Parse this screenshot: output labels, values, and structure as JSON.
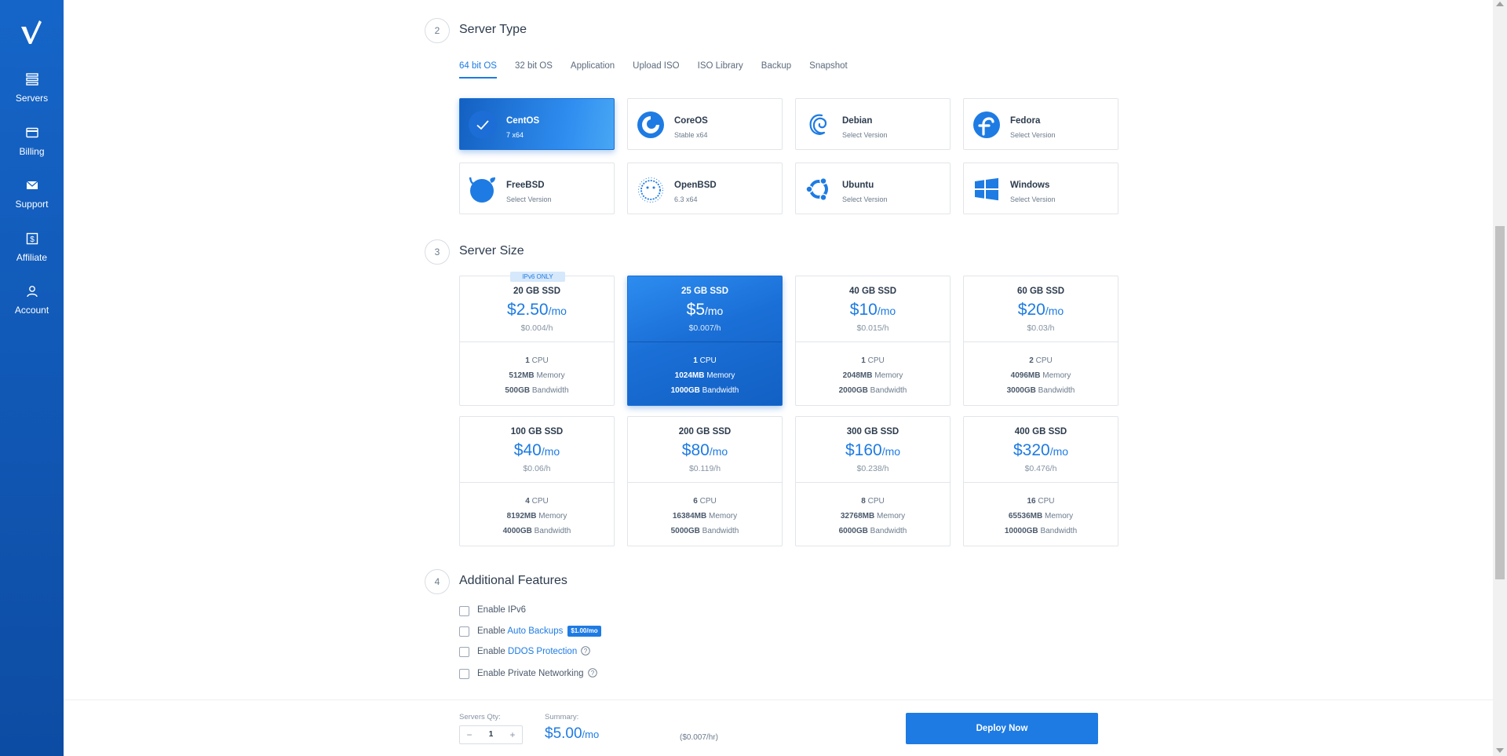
{
  "sidebar": {
    "items": [
      {
        "label": "Servers",
        "icon": "servers-icon"
      },
      {
        "label": "Billing",
        "icon": "billing-icon"
      },
      {
        "label": "Support",
        "icon": "support-icon"
      },
      {
        "label": "Affiliate",
        "icon": "affiliate-icon"
      },
      {
        "label": "Account",
        "icon": "account-icon"
      }
    ]
  },
  "server_type": {
    "step": "2",
    "title": "Server Type",
    "tabs": [
      "64 bit OS",
      "32 bit OS",
      "Application",
      "Upload ISO",
      "ISO Library",
      "Backup",
      "Snapshot"
    ],
    "active_tab": "64 bit OS",
    "os": [
      {
        "name": "CentOS",
        "sub": "7  x64",
        "selected": true
      },
      {
        "name": "CoreOS",
        "sub": "Stable  x64"
      },
      {
        "name": "Debian",
        "sub": "Select Version"
      },
      {
        "name": "Fedora",
        "sub": "Select Version"
      },
      {
        "name": "FreeBSD",
        "sub": "Select Version"
      },
      {
        "name": "OpenBSD",
        "sub": "6.3  x64"
      },
      {
        "name": "Ubuntu",
        "sub": "Select Version"
      },
      {
        "name": "Windows",
        "sub": "Select Version"
      }
    ]
  },
  "server_size": {
    "step": "3",
    "title": "Server Size",
    "ipv6_badge": "IPv6 ONLY",
    "plans": [
      {
        "name": "20 GB SSD",
        "price": "$2.50",
        "per": "/mo",
        "hourly": "$0.004/h",
        "cpu": "1",
        "cpu_label": "CPU",
        "memory": "512MB",
        "memory_label": "Memory",
        "bandwidth": "500GB",
        "bandwidth_label": "Bandwidth"
      },
      {
        "name": "25 GB SSD",
        "price": "$5",
        "per": "/mo",
        "hourly": "$0.007/h",
        "cpu": "1",
        "cpu_label": "CPU",
        "memory": "1024MB",
        "memory_label": "Memory",
        "bandwidth": "1000GB",
        "bandwidth_label": "Bandwidth",
        "selected": true
      },
      {
        "name": "40 GB SSD",
        "price": "$10",
        "per": "/mo",
        "hourly": "$0.015/h",
        "cpu": "1",
        "cpu_label": "CPU",
        "memory": "2048MB",
        "memory_label": "Memory",
        "bandwidth": "2000GB",
        "bandwidth_label": "Bandwidth"
      },
      {
        "name": "60 GB SSD",
        "price": "$20",
        "per": "/mo",
        "hourly": "$0.03/h",
        "cpu": "2",
        "cpu_label": "CPU",
        "memory": "4096MB",
        "memory_label": "Memory",
        "bandwidth": "3000GB",
        "bandwidth_label": "Bandwidth"
      },
      {
        "name": "100 GB SSD",
        "price": "$40",
        "per": "/mo",
        "hourly": "$0.06/h",
        "cpu": "4",
        "cpu_label": "CPU",
        "memory": "8192MB",
        "memory_label": "Memory",
        "bandwidth": "4000GB",
        "bandwidth_label": "Bandwidth"
      },
      {
        "name": "200 GB SSD",
        "price": "$80",
        "per": "/mo",
        "hourly": "$0.119/h",
        "cpu": "6",
        "cpu_label": "CPU",
        "memory": "16384MB",
        "memory_label": "Memory",
        "bandwidth": "5000GB",
        "bandwidth_label": "Bandwidth"
      },
      {
        "name": "300 GB SSD",
        "price": "$160",
        "per": "/mo",
        "hourly": "$0.238/h",
        "cpu": "8",
        "cpu_label": "CPU",
        "memory": "32768MB",
        "memory_label": "Memory",
        "bandwidth": "6000GB",
        "bandwidth_label": "Bandwidth"
      },
      {
        "name": "400 GB SSD",
        "price": "$320",
        "per": "/mo",
        "hourly": "$0.476/h",
        "cpu": "16",
        "cpu_label": "CPU",
        "memory": "65536MB",
        "memory_label": "Memory",
        "bandwidth": "10000GB",
        "bandwidth_label": "Bandwidth"
      }
    ]
  },
  "features": {
    "step": "4",
    "title": "Additional Features",
    "ipv6": {
      "prefix": "Enable IPv6"
    },
    "backups": {
      "prefix": "Enable ",
      "link": "Auto Backups",
      "badge": "$1.00/mo"
    },
    "ddos": {
      "prefix": "Enable ",
      "link": "DDOS Protection"
    },
    "private": {
      "prefix": "Enable Private Networking"
    }
  },
  "footer": {
    "qty_label": "Servers Qty:",
    "qty_value": "1",
    "minus": "−",
    "plus": "+",
    "summary_label": "Summary:",
    "summary_price": "$5.00",
    "summary_per": "/mo",
    "summary_hourly": "($0.007/hr)",
    "deploy_label": "Deploy Now"
  },
  "colors": {
    "accent": "#1e7be3",
    "sidebar": "#1565c8"
  }
}
